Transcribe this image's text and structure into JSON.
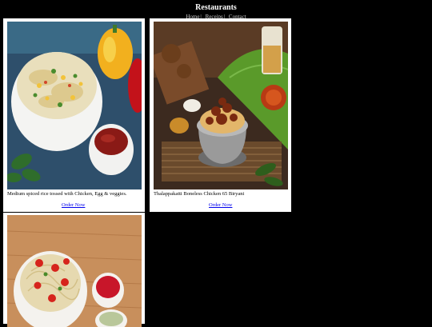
{
  "header": {
    "title": "Restaurants",
    "nav": [
      "Home",
      "Receips",
      "Contact"
    ],
    "separators": [
      "|",
      "|"
    ]
  },
  "cards": [
    {
      "description": "Medium spiced rice tossed with Chicken, Egg & veggies.",
      "order_label": "Order Now",
      "photo_icon": "fried-rice-photo"
    },
    {
      "description": "Thalappakatti Boneless Chicken 65 Biryani",
      "order_label": "Order Now",
      "photo_icon": "biryani-photo"
    },
    {
      "description": "",
      "order_label": "",
      "photo_icon": "noodles-photo"
    }
  ],
  "colors": {
    "background": "#000000",
    "card": "#ffffff",
    "link": "#0000ee"
  }
}
